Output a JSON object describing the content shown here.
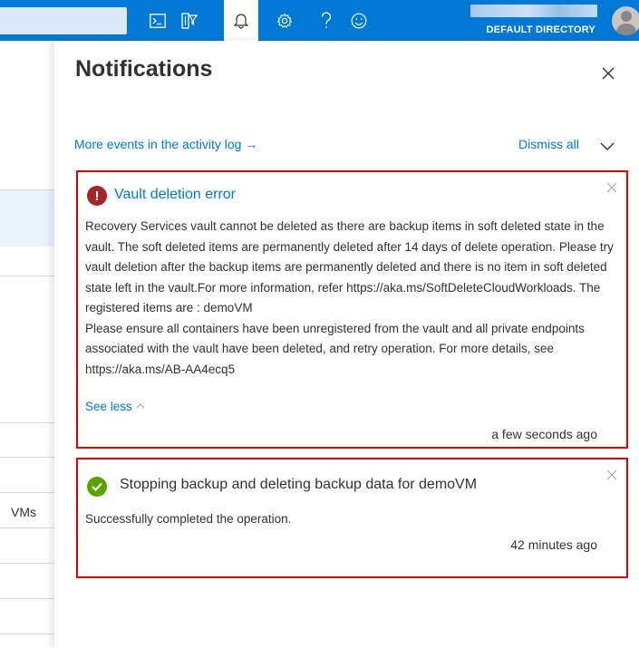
{
  "topbar": {
    "icons": [
      "cloud-shell-icon",
      "directory-filter-icon",
      "notifications-bell-icon",
      "settings-gear-icon",
      "help-icon",
      "feedback-smiley-icon"
    ],
    "account_directory": "DEFAULT DIRECTORY",
    "accent_color": "#0078d4"
  },
  "background_blade": {
    "visible_text": "VMs"
  },
  "notifications_panel": {
    "title": "Notifications",
    "activity_log_link": "More events in the activity log →",
    "dismiss_all": "Dismiss all",
    "items": [
      {
        "status": "error",
        "status_icon": "error-icon",
        "status_color": "#a4262c",
        "title": "Vault deletion error",
        "body_paragraphs": [
          "Recovery Services vault cannot be deleted as there are backup items in soft deleted state in the vault. The soft deleted items are permanently deleted after 14 days of delete operation. Please try vault deletion after the backup items are permanently deleted and there is no item in soft deleted state left in the vault.For more information, refer https://aka.ms/SoftDeleteCloudWorkloads. The registered items are : demoVM",
          "Please ensure all containers have been unregistered from the vault and all private endpoints associated with the vault have been deleted, and retry operation. For more details, see https://aka.ms/AB-AA4ecq5"
        ],
        "toggle_label": "See less",
        "timestamp": "a few seconds ago"
      },
      {
        "status": "success",
        "status_icon": "success-check-icon",
        "status_color": "#57a300",
        "title": "Stopping backup and deleting backup data for demoVM",
        "body": "Successfully completed the operation.",
        "timestamp": "42 minutes ago"
      }
    ],
    "highlight_border_color": "#e00000"
  }
}
